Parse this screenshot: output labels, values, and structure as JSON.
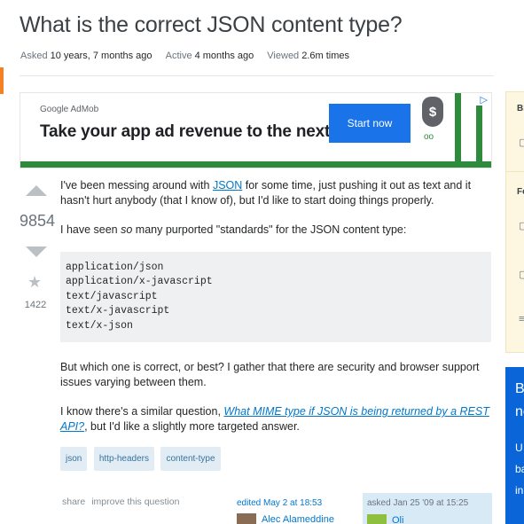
{
  "question": {
    "title": "What is the correct JSON content type?",
    "meta": {
      "asked_label": "Asked",
      "asked_value": "10 years, 7 months ago",
      "active_label": "Active",
      "active_value": "4 months ago",
      "viewed_label": "Viewed",
      "viewed_value": "2.6m times"
    },
    "votes": "9854",
    "favorites": "1422",
    "body": {
      "p1_pre": "I've been messing around with ",
      "p1_link": "JSON",
      "p1_post": " for some time, just pushing it out as text and it hasn't hurt anybody (that I know of), but I'd like to start doing things properly.",
      "p2_pre": "I have seen ",
      "p2_em": "so",
      "p2_post": " many purported \"standards\" for the JSON content type:",
      "code": "application/json\napplication/x-javascript\ntext/javascript\ntext/x-javascript\ntext/x-json",
      "p3": "But which one is correct, or best? I gather that there are security and browser support issues varying between them.",
      "p4_pre": "I know there's a similar question, ",
      "p4_link": "What MIME type if JSON is being returned by a REST API?",
      "p4_post": ", but I'd like a slightly more targeted answer."
    },
    "tags": [
      "json",
      "http-headers",
      "content-type"
    ],
    "menu": {
      "share": "share",
      "improve": "improve this question"
    },
    "edited": {
      "label": "edited May 2 at 18:53",
      "user": "Alec Alameddine"
    },
    "asked": {
      "label": "asked Jan 25 '09 at 15:25",
      "user": "Oli"
    }
  },
  "ad": {
    "brand": "Google AdMob",
    "headline": "Take your app ad revenue to the next level.",
    "cta": "Start now",
    "bag_symbol": "$",
    "eyes": "oo",
    "choices_icon": "▷"
  },
  "sidebar": {
    "box1_heading_fragment": "Bl",
    "box1_heading2_fragment": "Fe",
    "box2_line1": "B",
    "box2_line2": "ne",
    "box2_line3": "U",
    "box2_line4": "ba",
    "box2_line5": "in"
  },
  "colors": {
    "accent": "#f48024",
    "link": "#0077cc",
    "tag_bg": "#e1ecf4",
    "tag_text": "#39739d",
    "ad_button": "#1a73e8",
    "ad_green": "#2e8b3c"
  }
}
